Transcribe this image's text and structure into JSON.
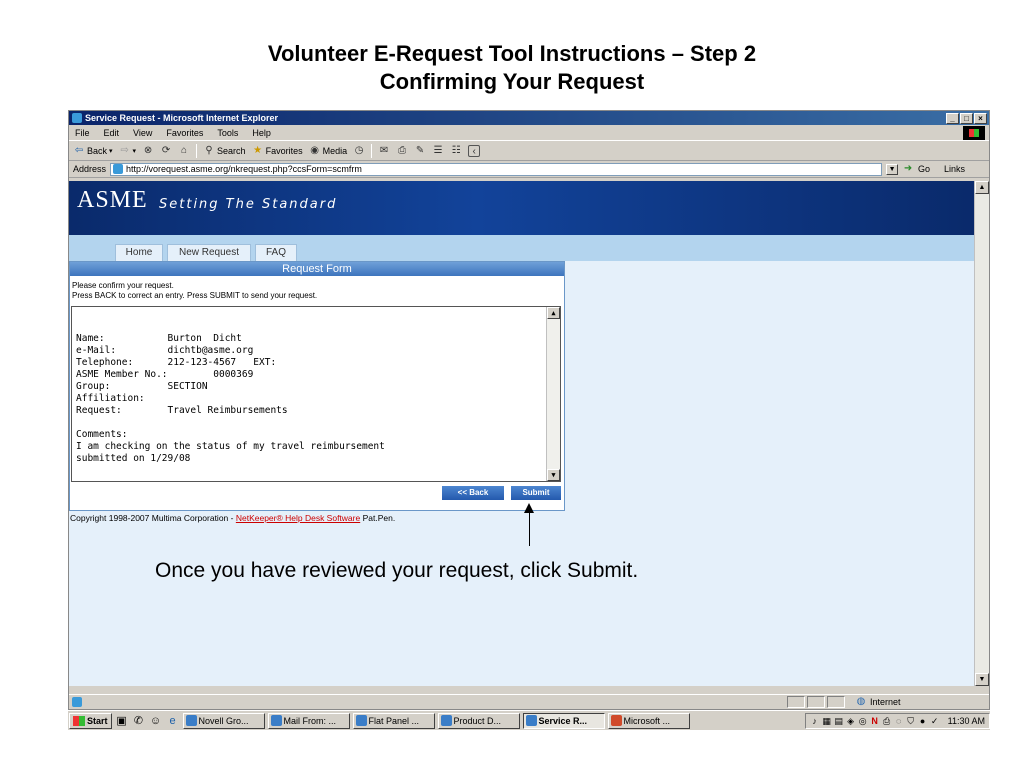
{
  "slide": {
    "title_line1": "Volunteer E-Request Tool Instructions – Step 2",
    "title_line2": "Confirming Your Request",
    "callout": "Once you have reviewed your request, click Submit."
  },
  "window": {
    "title": "Service Request - Microsoft Internet Explorer",
    "controls": [
      "_",
      "□",
      "×"
    ]
  },
  "menu": [
    "File",
    "Edit",
    "View",
    "Favorites",
    "Tools",
    "Help"
  ],
  "toolbar": {
    "back": "Back",
    "search": "Search",
    "favorites": "Favorites",
    "media": "Media"
  },
  "address": {
    "label": "Address",
    "url": "http://vorequest.asme.org/nkrequest.php?ccsForm=scmfrm",
    "go": "Go",
    "links": "Links"
  },
  "site": {
    "logo": "ASME",
    "tagline": "Setting The Standard",
    "tabs": [
      "Home",
      "New Request",
      "FAQ"
    ]
  },
  "form": {
    "header": "Request Form",
    "instruction1": "Please confirm your request.",
    "instruction2": "Press BACK to correct an entry. Press SUBMIT to send your request.",
    "content": "Name:           Burton  Dicht\ne-Mail:         dichtb@asme.org\nTelephone:      212-123-4567   EXT:\nASME Member No.:        0000369\nGroup:          SECTION\nAffiliation:\nRequest:        Travel Reimbursements\n\nComments:\nI am checking on the status of my travel reimbursement\nsubmitted on 1/29/08",
    "back_button": "<< Back",
    "submit_button": "Submit"
  },
  "footer": {
    "copyright_prefix": "Copyright 1998-2007 Multima Corporation - ",
    "link": "NetKeeper® Help Desk Software",
    "suffix": " Pat.Pen."
  },
  "status_bar": {
    "zone": "Internet"
  },
  "taskbar": {
    "start": "Start",
    "tasks": [
      "Novell Gro...",
      "Mail From: ...",
      "Flat Panel ...",
      "Product D...",
      "Service R...",
      "Microsoft ..."
    ],
    "active_task_index": 4,
    "clock": "11:30 AM"
  },
  "colors": {
    "banner": "#0a2a6b",
    "nav_strip": "#b3d4ee",
    "content_bg": "#e5f0fa",
    "button": "#2459ad",
    "link": "#cc0000"
  }
}
